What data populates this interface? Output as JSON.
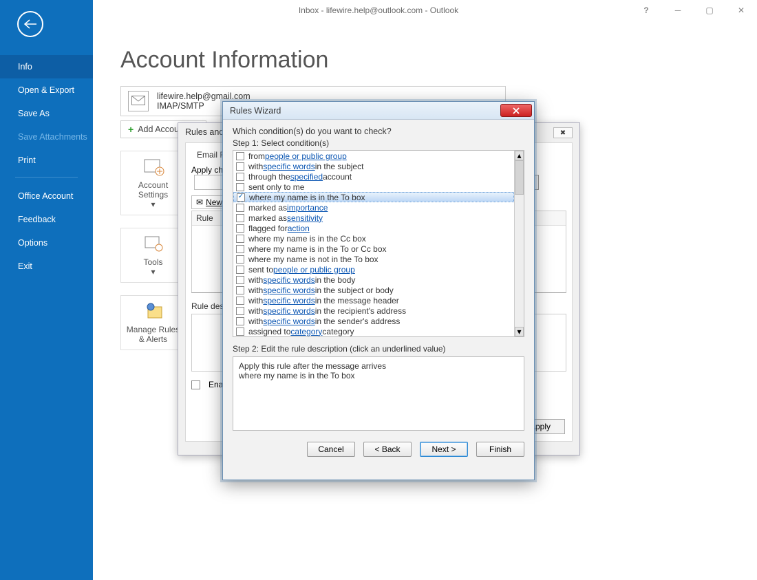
{
  "titlebar": {
    "text": "Inbox - lifewire.help@outlook.com  -  Outlook",
    "help": "?",
    "minimize": "─",
    "maximize": "▢",
    "close": "✕"
  },
  "sidebar": {
    "items": [
      {
        "label": "Info",
        "selected": true
      },
      {
        "label": "Open & Export"
      },
      {
        "label": "Save As"
      },
      {
        "label": "Save Attachments",
        "disabled": true
      },
      {
        "label": "Print"
      }
    ],
    "items2": [
      {
        "label": "Office Account"
      },
      {
        "label": "Feedback"
      },
      {
        "label": "Options"
      },
      {
        "label": "Exit"
      }
    ]
  },
  "page": {
    "title": "Account Information",
    "email": "lifewire.help@gmail.com",
    "protocol": "IMAP/SMTP",
    "add_account": "Add Account",
    "blocks": {
      "settings": "Account Settings",
      "tools": "Tools",
      "rules": "Manage Rules & Alerts"
    }
  },
  "rules_alerts": {
    "title": "Rules and Alerts",
    "tab": "Email Rules",
    "apply_label": "Apply changes",
    "new_rule": "New Rule",
    "list_header": "Rule",
    "rule_desc_label": "Rule description",
    "enable_label": "Enable",
    "buttons": {
      "apply": "Apply"
    }
  },
  "wizard": {
    "title": "Rules Wizard",
    "question": "Which condition(s) do you want to check?",
    "step1": "Step 1: Select condition(s)",
    "conditions": [
      {
        "parts": [
          {
            "t": "from "
          },
          {
            "t": "people or public group",
            "link": true
          }
        ]
      },
      {
        "parts": [
          {
            "t": "with "
          },
          {
            "t": "specific words",
            "link": true
          },
          {
            "t": " in the subject"
          }
        ]
      },
      {
        "parts": [
          {
            "t": "through the "
          },
          {
            "t": "specified",
            "link": true
          },
          {
            "t": " account"
          }
        ]
      },
      {
        "parts": [
          {
            "t": "sent only to me"
          }
        ]
      },
      {
        "parts": [
          {
            "t": "where my name is in the To box"
          }
        ],
        "checked": true,
        "highlight": true
      },
      {
        "parts": [
          {
            "t": "marked as "
          },
          {
            "t": "importance",
            "link": true
          }
        ]
      },
      {
        "parts": [
          {
            "t": "marked as "
          },
          {
            "t": "sensitivity",
            "link": true
          }
        ]
      },
      {
        "parts": [
          {
            "t": "flagged for "
          },
          {
            "t": "action",
            "link": true
          }
        ]
      },
      {
        "parts": [
          {
            "t": "where my name is in the Cc box"
          }
        ]
      },
      {
        "parts": [
          {
            "t": "where my name is in the To or Cc box"
          }
        ]
      },
      {
        "parts": [
          {
            "t": "where my name is not in the To box"
          }
        ]
      },
      {
        "parts": [
          {
            "t": "sent to "
          },
          {
            "t": "people or public group",
            "link": true
          }
        ]
      },
      {
        "parts": [
          {
            "t": "with "
          },
          {
            "t": "specific words",
            "link": true
          },
          {
            "t": " in the body"
          }
        ]
      },
      {
        "parts": [
          {
            "t": "with "
          },
          {
            "t": "specific words",
            "link": true
          },
          {
            "t": " in the subject or body"
          }
        ]
      },
      {
        "parts": [
          {
            "t": "with "
          },
          {
            "t": "specific words",
            "link": true
          },
          {
            "t": " in the message header"
          }
        ]
      },
      {
        "parts": [
          {
            "t": "with "
          },
          {
            "t": "specific words",
            "link": true
          },
          {
            "t": " in the recipient's address"
          }
        ]
      },
      {
        "parts": [
          {
            "t": "with "
          },
          {
            "t": "specific words",
            "link": true
          },
          {
            "t": " in the sender's address"
          }
        ]
      },
      {
        "parts": [
          {
            "t": "assigned to "
          },
          {
            "t": "category",
            "link": true
          },
          {
            "t": " category"
          }
        ]
      }
    ],
    "step2": "Step 2: Edit the rule description (click an underlined value)",
    "description": [
      "Apply this rule after the message arrives",
      "where my name is in the To box"
    ],
    "buttons": {
      "cancel": "Cancel",
      "back": "< Back",
      "next": "Next >",
      "finish": "Finish"
    }
  }
}
